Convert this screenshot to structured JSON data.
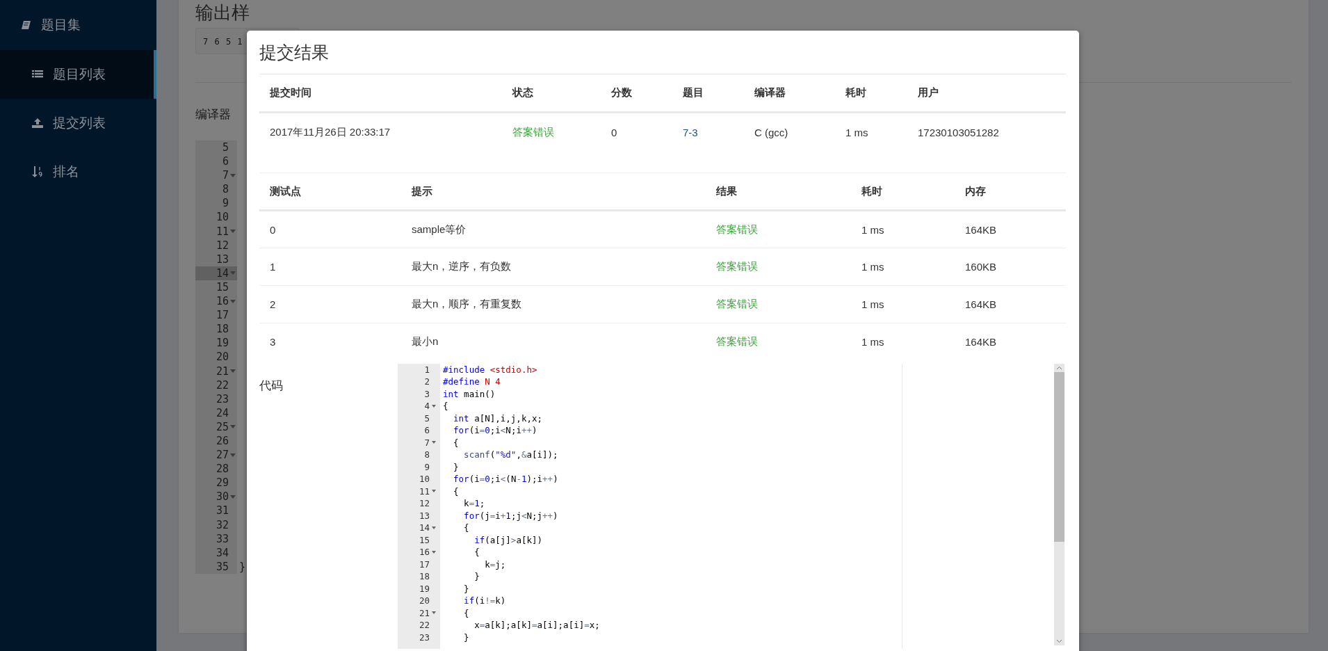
{
  "sidebar": {
    "items": [
      {
        "label": "题目集",
        "kind": "group",
        "selected": false
      },
      {
        "label": "题目列表",
        "kind": "page",
        "selected": true
      },
      {
        "label": "提交列表",
        "kind": "page",
        "selected": false
      },
      {
        "label": "排名",
        "kind": "page",
        "selected": false
      }
    ]
  },
  "background_page": {
    "heading": "输出样",
    "sample_output": "7 6 5 1",
    "compiler_label": "编译器",
    "editor_lines": [
      {
        "number": "5",
        "foldable": false,
        "active": false
      },
      {
        "number": "6",
        "foldable": false,
        "active": false
      },
      {
        "number": "7",
        "foldable": true,
        "active": false
      },
      {
        "number": "8",
        "foldable": false,
        "active": false
      },
      {
        "number": "9",
        "foldable": false,
        "active": false
      },
      {
        "number": "10",
        "foldable": false,
        "active": false
      },
      {
        "number": "11",
        "foldable": true,
        "active": false
      },
      {
        "number": "12",
        "foldable": false,
        "active": false
      },
      {
        "number": "13",
        "foldable": false,
        "active": false
      },
      {
        "number": "14",
        "foldable": true,
        "active": true
      },
      {
        "number": "15",
        "foldable": false,
        "active": false
      },
      {
        "number": "16",
        "foldable": true,
        "active": false
      },
      {
        "number": "17",
        "foldable": false,
        "active": false
      },
      {
        "number": "18",
        "foldable": false,
        "active": false
      },
      {
        "number": "19",
        "foldable": false,
        "active": false
      },
      {
        "number": "20",
        "foldable": false,
        "active": false
      },
      {
        "number": "21",
        "foldable": true,
        "active": false
      },
      {
        "number": "22",
        "foldable": false,
        "active": false
      },
      {
        "number": "23",
        "foldable": false,
        "active": false
      },
      {
        "number": "24",
        "foldable": false,
        "active": false
      },
      {
        "number": "25",
        "foldable": true,
        "active": false
      },
      {
        "number": "26",
        "foldable": false,
        "active": false
      },
      {
        "number": "27",
        "foldable": true,
        "active": false
      },
      {
        "number": "28",
        "foldable": false,
        "active": false
      },
      {
        "number": "29",
        "foldable": false,
        "active": false
      },
      {
        "number": "30",
        "foldable": true,
        "active": false
      },
      {
        "number": "31",
        "foldable": false,
        "active": false
      },
      {
        "number": "32",
        "foldable": false,
        "active": false
      },
      {
        "number": "33",
        "foldable": false,
        "active": false
      },
      {
        "number": "34",
        "foldable": false,
        "active": false
      },
      {
        "number": "35",
        "foldable": false,
        "active": false,
        "text": "}"
      }
    ]
  },
  "modal": {
    "title": "提交结果",
    "submission_table": {
      "columns": [
        {
          "label": "提交时间",
          "kind": "text"
        },
        {
          "label": "状态",
          "kind": "status"
        },
        {
          "label": "分数",
          "kind": "text"
        },
        {
          "label": "题目",
          "kind": "link"
        },
        {
          "label": "编译器",
          "kind": "text"
        },
        {
          "label": "耗时",
          "kind": "text"
        },
        {
          "label": "用户",
          "kind": "text"
        }
      ],
      "rows": [
        [
          "2017年11月26日 20:33:17",
          "答案错误",
          "0",
          "7-3",
          "C (gcc)",
          "1 ms",
          "17230103051282"
        ]
      ]
    },
    "testcase_table": {
      "columns": [
        {
          "label": "测试点",
          "kind": "text"
        },
        {
          "label": "提示",
          "kind": "text"
        },
        {
          "label": "结果",
          "kind": "status"
        },
        {
          "label": "耗时",
          "kind": "text"
        },
        {
          "label": "内存",
          "kind": "text"
        }
      ],
      "rows": [
        [
          "0",
          "sample等价",
          "答案错误",
          "1 ms",
          "164KB"
        ],
        [
          "1",
          "最大n，逆序，有负数",
          "答案错误",
          "1 ms",
          "160KB"
        ],
        [
          "2",
          "最大n，顺序，有重复数",
          "答案错误",
          "1 ms",
          "164KB"
        ],
        [
          "3",
          "最小n",
          "答案错误",
          "1 ms",
          "164KB"
        ]
      ]
    },
    "code": {
      "label": "代码",
      "lines": [
        {
          "number": "1",
          "foldable": false,
          "tokens": [
            {
              "kind": "pre",
              "text": "#include"
            },
            {
              "kind": "str",
              "text": " <stdio.h>"
            }
          ]
        },
        {
          "number": "2",
          "foldable": false,
          "tokens": [
            {
              "kind": "pre",
              "text": "#define"
            },
            {
              "kind": "str",
              "text": " N 4"
            }
          ]
        },
        {
          "number": "3",
          "foldable": false,
          "tokens": [
            {
              "kind": "kw",
              "text": "int"
            },
            {
              "kind": "plain",
              "text": " main()"
            }
          ]
        },
        {
          "number": "4",
          "foldable": true,
          "tokens": [
            {
              "kind": "plain",
              "text": "{"
            }
          ]
        },
        {
          "number": "5",
          "foldable": false,
          "tokens": [
            {
              "kind": "kw",
              "text": "  int"
            },
            {
              "kind": "plain",
              "text": " a[N],i,j,k,x;"
            }
          ]
        },
        {
          "number": "6",
          "foldable": false,
          "tokens": [
            {
              "kind": "kw",
              "text": "  for"
            },
            {
              "kind": "plain",
              "text": "(i"
            },
            {
              "kind": "op",
              "text": "="
            },
            {
              "kind": "num",
              "text": "0"
            },
            {
              "kind": "plain",
              "text": ";i"
            },
            {
              "kind": "op",
              "text": "<"
            },
            {
              "kind": "plain",
              "text": "N;i"
            },
            {
              "kind": "op",
              "text": "++"
            },
            {
              "kind": "plain",
              "text": ")"
            }
          ]
        },
        {
          "number": "7",
          "foldable": true,
          "tokens": [
            {
              "kind": "plain",
              "text": "  {"
            }
          ]
        },
        {
          "number": "8",
          "foldable": false,
          "tokens": [
            {
              "kind": "fn",
              "text": "    scanf"
            },
            {
              "kind": "plain",
              "text": "("
            },
            {
              "kind": "fmt",
              "text": "\"%d\""
            },
            {
              "kind": "plain",
              "text": ","
            },
            {
              "kind": "op",
              "text": "&"
            },
            {
              "kind": "plain",
              "text": "a[i]);"
            }
          ]
        },
        {
          "number": "9",
          "foldable": false,
          "tokens": [
            {
              "kind": "plain",
              "text": "  }"
            }
          ]
        },
        {
          "number": "10",
          "foldable": false,
          "tokens": [
            {
              "kind": "kw",
              "text": "  for"
            },
            {
              "kind": "plain",
              "text": "(i"
            },
            {
              "kind": "op",
              "text": "="
            },
            {
              "kind": "num",
              "text": "0"
            },
            {
              "kind": "plain",
              "text": ";i"
            },
            {
              "kind": "op",
              "text": "<"
            },
            {
              "kind": "plain",
              "text": "(N"
            },
            {
              "kind": "op",
              "text": "-"
            },
            {
              "kind": "num",
              "text": "1"
            },
            {
              "kind": "plain",
              "text": ");i"
            },
            {
              "kind": "op",
              "text": "++"
            },
            {
              "kind": "plain",
              "text": ")"
            }
          ]
        },
        {
          "number": "11",
          "foldable": true,
          "tokens": [
            {
              "kind": "plain",
              "text": "  {"
            }
          ]
        },
        {
          "number": "12",
          "foldable": false,
          "tokens": [
            {
              "kind": "plain",
              "text": "    k"
            },
            {
              "kind": "op",
              "text": "="
            },
            {
              "kind": "num",
              "text": "1"
            },
            {
              "kind": "plain",
              "text": ";"
            }
          ]
        },
        {
          "number": "13",
          "foldable": false,
          "tokens": [
            {
              "kind": "kw",
              "text": "    for"
            },
            {
              "kind": "plain",
              "text": "(j"
            },
            {
              "kind": "op",
              "text": "="
            },
            {
              "kind": "plain",
              "text": "i"
            },
            {
              "kind": "op",
              "text": "+"
            },
            {
              "kind": "num",
              "text": "1"
            },
            {
              "kind": "plain",
              "text": ";j"
            },
            {
              "kind": "op",
              "text": "<"
            },
            {
              "kind": "plain",
              "text": "N;j"
            },
            {
              "kind": "op",
              "text": "++"
            },
            {
              "kind": "plain",
              "text": ")"
            }
          ]
        },
        {
          "number": "14",
          "foldable": true,
          "tokens": [
            {
              "kind": "plain",
              "text": "    {"
            }
          ]
        },
        {
          "number": "15",
          "foldable": false,
          "tokens": [
            {
              "kind": "kw",
              "text": "      if"
            },
            {
              "kind": "plain",
              "text": "(a[j]"
            },
            {
              "kind": "op",
              "text": ">"
            },
            {
              "kind": "plain",
              "text": "a[k])"
            }
          ]
        },
        {
          "number": "16",
          "foldable": true,
          "tokens": [
            {
              "kind": "plain",
              "text": "      {"
            }
          ]
        },
        {
          "number": "17",
          "foldable": false,
          "tokens": [
            {
              "kind": "plain",
              "text": "        k"
            },
            {
              "kind": "op",
              "text": "="
            },
            {
              "kind": "plain",
              "text": "j;"
            }
          ]
        },
        {
          "number": "18",
          "foldable": false,
          "tokens": [
            {
              "kind": "plain",
              "text": "      }"
            }
          ]
        },
        {
          "number": "19",
          "foldable": false,
          "tokens": [
            {
              "kind": "plain",
              "text": "    }"
            }
          ]
        },
        {
          "number": "20",
          "foldable": false,
          "tokens": [
            {
              "kind": "kw",
              "text": "    if"
            },
            {
              "kind": "plain",
              "text": "(i"
            },
            {
              "kind": "op",
              "text": "!="
            },
            {
              "kind": "plain",
              "text": "k)"
            }
          ]
        },
        {
          "number": "21",
          "foldable": true,
          "tokens": [
            {
              "kind": "plain",
              "text": "    {"
            }
          ]
        },
        {
          "number": "22",
          "foldable": false,
          "tokens": [
            {
              "kind": "plain",
              "text": "      x"
            },
            {
              "kind": "op",
              "text": "="
            },
            {
              "kind": "plain",
              "text": "a[k];a[k]"
            },
            {
              "kind": "op",
              "text": "="
            },
            {
              "kind": "plain",
              "text": "a[i];a[i]"
            },
            {
              "kind": "op",
              "text": "="
            },
            {
              "kind": "plain",
              "text": "x;"
            }
          ]
        },
        {
          "number": "23",
          "foldable": false,
          "tokens": [
            {
              "kind": "plain",
              "text": "    }"
            }
          ]
        }
      ]
    }
  }
}
